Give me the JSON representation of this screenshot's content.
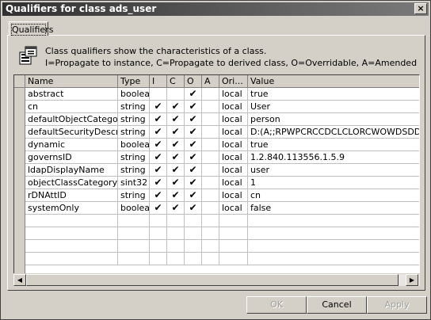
{
  "window": {
    "title": "Qualifiers for class ads_user",
    "close_glyph": "×"
  },
  "tab": {
    "label": "Qualifiers"
  },
  "info": {
    "icon": "class-qualifiers-icon",
    "line1": "Class qualifiers show the characteristics of a class.",
    "line2": "I=Propagate to instance, C=Propagate to derived class, O=Overridable, A=Amended"
  },
  "grid": {
    "columns": [
      "Name",
      "Type",
      "I",
      "C",
      "O",
      "A",
      "Ori...",
      "Value"
    ],
    "rows": [
      {
        "name": "abstract",
        "type": "boolean",
        "i": "",
        "c": "",
        "o": "✔",
        "a": "",
        "origin": "local",
        "value": "true"
      },
      {
        "name": "cn",
        "type": "string",
        "i": "✔",
        "c": "✔",
        "o": "✔",
        "a": "",
        "origin": "local",
        "value": "User"
      },
      {
        "name": "defaultObjectCategory",
        "type": "string",
        "i": "✔",
        "c": "✔",
        "o": "✔",
        "a": "",
        "origin": "local",
        "value": "person"
      },
      {
        "name": "defaultSecurityDescriptor",
        "type": "string",
        "i": "✔",
        "c": "✔",
        "o": "✔",
        "a": "",
        "origin": "local",
        "value": "D:(A;;RPWPCRCCDCLCLORCWOWDSDDTSV"
      },
      {
        "name": "dynamic",
        "type": "boolean",
        "i": "✔",
        "c": "✔",
        "o": "✔",
        "a": "",
        "origin": "local",
        "value": "true"
      },
      {
        "name": "governsID",
        "type": "string",
        "i": "✔",
        "c": "✔",
        "o": "✔",
        "a": "",
        "origin": "local",
        "value": "1.2.840.113556.1.5.9"
      },
      {
        "name": "ldapDisplayName",
        "type": "string",
        "i": "✔",
        "c": "✔",
        "o": "✔",
        "a": "",
        "origin": "local",
        "value": "user"
      },
      {
        "name": "objectClassCategory",
        "type": "sint32",
        "i": "✔",
        "c": "✔",
        "o": "✔",
        "a": "",
        "origin": "local",
        "value": "1"
      },
      {
        "name": "rDNAttID",
        "type": "string",
        "i": "✔",
        "c": "✔",
        "o": "✔",
        "a": "",
        "origin": "local",
        "value": "cn"
      },
      {
        "name": "systemOnly",
        "type": "boolean",
        "i": "✔",
        "c": "✔",
        "o": "✔",
        "a": "",
        "origin": "local",
        "value": "false"
      }
    ]
  },
  "scrollbar": {
    "left_arrow": "◀",
    "right_arrow": "▶"
  },
  "buttons": {
    "ok": "OK",
    "cancel": "Cancel",
    "apply": "Apply"
  }
}
